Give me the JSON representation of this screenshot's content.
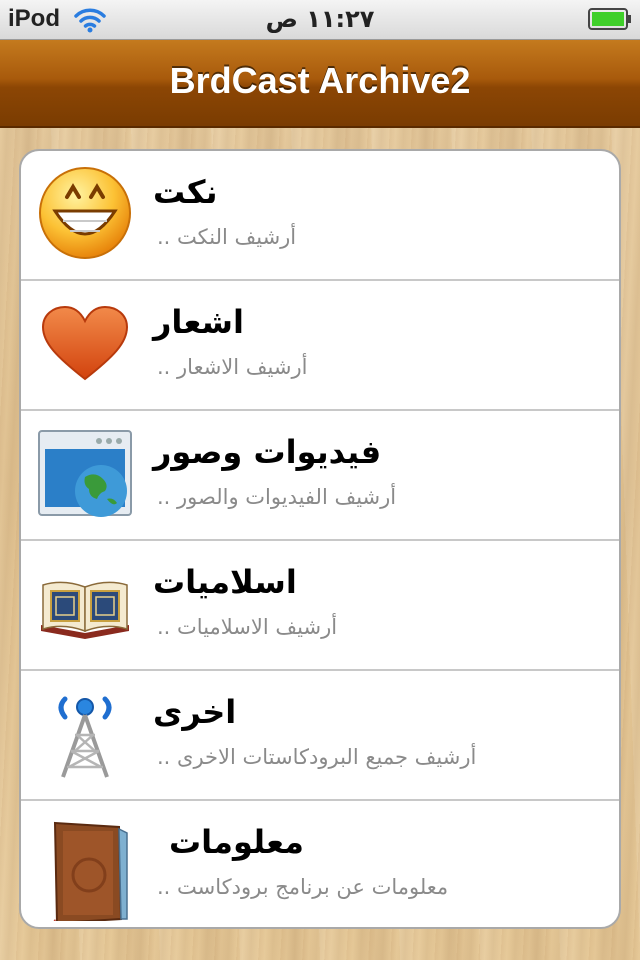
{
  "status_bar": {
    "carrier": "iPod",
    "time": "١١:٢٧ ص",
    "wifi_icon": "wifi-icon",
    "battery_icon": "battery-icon",
    "battery_color": "#3fcf2a"
  },
  "nav": {
    "title": "BrdCast Archive2",
    "bar_color": "#9a5008"
  },
  "rows": [
    {
      "title": "نكت",
      "subtitle": "أرشيف النكت ..",
      "icon": "smiley-icon"
    },
    {
      "title": "اشعار",
      "subtitle": "أرشيف الاشعار ..",
      "icon": "heart-icon"
    },
    {
      "title": "فيديوات وصور",
      "subtitle": "أرشيف الفيديوات والصور ..",
      "icon": "globe-window-icon"
    },
    {
      "title": "اسلاميات",
      "subtitle": "أرشيف الاسلاميات ..",
      "icon": "quran-book-icon"
    },
    {
      "title": "اخرى",
      "subtitle": "أرشيف جميع البرودكاستات الاخرى ..",
      "icon": "broadcast-tower-icon"
    },
    {
      "title": "معلومات",
      "subtitle": "معلومات عن برنامج برودكاست ..",
      "icon": "info-book-icon"
    }
  ]
}
